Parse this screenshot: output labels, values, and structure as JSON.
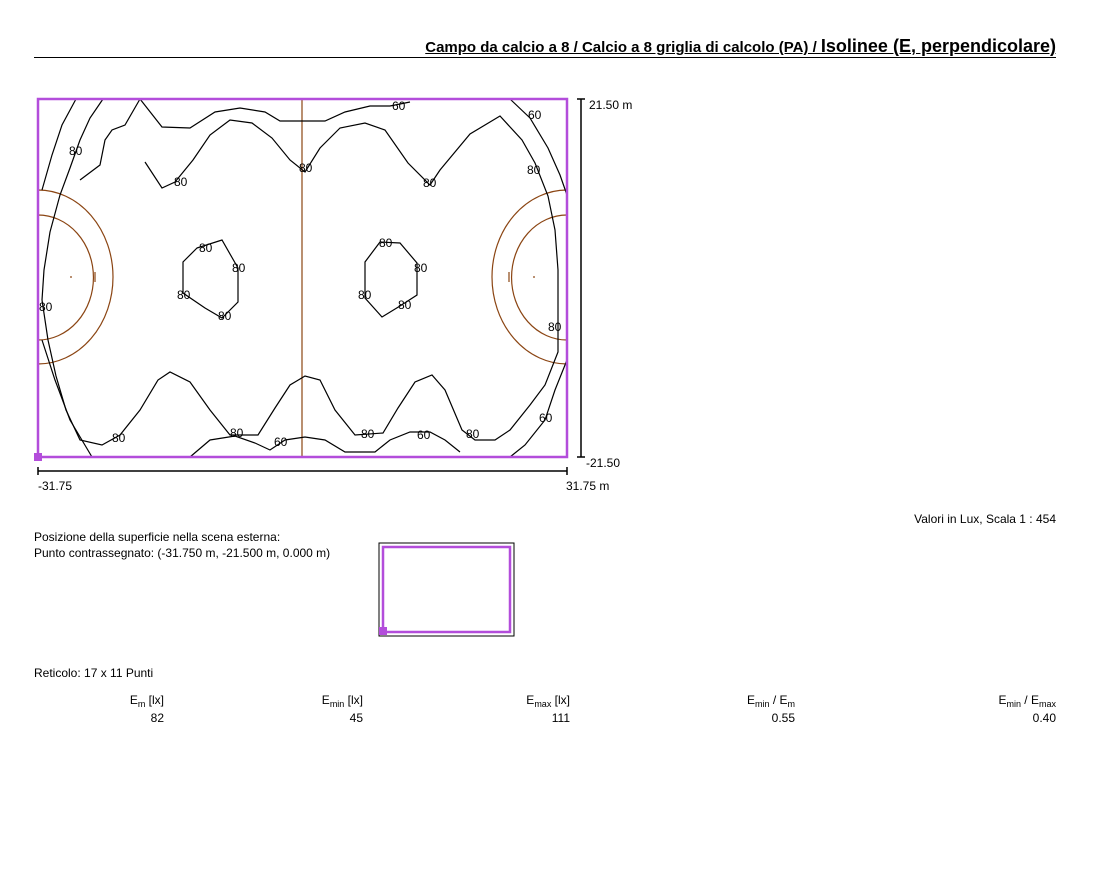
{
  "header": {
    "title_part1": "Campo da calcio a 8 / Calcio a 8 griglia di calcolo (PA) / ",
    "title_part2": "Isolinee (E, perpendicolare)"
  },
  "colors": {
    "frame": "#b34ddb",
    "pitch_lines": "#8b4513",
    "isolines": "#000000"
  },
  "plot": {
    "y_max_label": "21.50 m",
    "y_min_label": "-21.50",
    "x_min_label": "-31.75",
    "x_max_label": "31.75 m",
    "isoline_labels": [
      "60",
      "60",
      "80",
      "80",
      "80",
      "80",
      "80",
      "80",
      "80",
      "80",
      "80",
      "80",
      "80",
      "80",
      "80",
      "80",
      "80",
      "80",
      "80",
      "80",
      "80",
      "60",
      "60",
      "60"
    ]
  },
  "scale_note": "Valori in Lux, Scala 1 : 454",
  "position": {
    "line1": "Posizione della superficie nella scena esterna:",
    "line2": "Punto contrassegnato: (-31.750 m, -21.500 m, 0.000 m)"
  },
  "grid": "Reticolo: 17 x 11 Punti",
  "stats": [
    {
      "label_main": "E",
      "label_sub": "m",
      "label_unit": " [lx]",
      "value": "82"
    },
    {
      "label_main": "E",
      "label_sub": "min",
      "label_unit": " [lx]",
      "value": "45"
    },
    {
      "label_main": "E",
      "label_sub": "max",
      "label_unit": " [lx]",
      "value": "111"
    },
    {
      "label_main": "E",
      "label_sub": "min",
      "label_mid": " / E",
      "label_sub2": "m",
      "value": "0.55"
    },
    {
      "label_main": "E",
      "label_sub": "min",
      "label_mid": " / E",
      "label_sub2": "max",
      "value": "0.40"
    }
  ]
}
